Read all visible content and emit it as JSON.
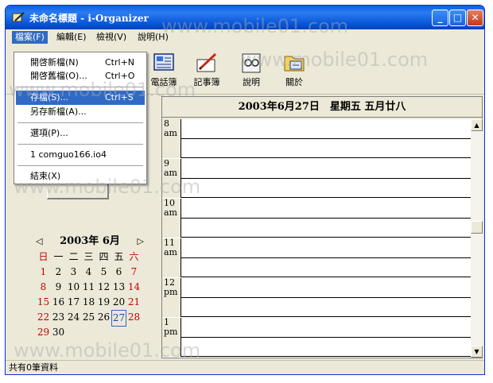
{
  "window": {
    "title": "未命名標題 - i-Organizer",
    "controls": {
      "minimize": "_",
      "maximize": "□",
      "close": "✕"
    }
  },
  "menubar": {
    "items": [
      "檔案(F)",
      "編輯(E)",
      "檢視(V)",
      "說明(H)"
    ]
  },
  "file_menu": {
    "items": [
      {
        "label": "開啓新檔(N)",
        "shortcut": "Ctrl+N"
      },
      {
        "label": "開啓舊檔(O)...",
        "shortcut": "Ctrl+O"
      },
      {
        "label": "存檔(S)...",
        "shortcut": "Ctrl+S"
      },
      {
        "label": "另存新檔(A)...",
        "shortcut": ""
      },
      {
        "label": "選項(P)...",
        "shortcut": ""
      },
      {
        "label": "1 comguo166.io4",
        "shortcut": ""
      },
      {
        "label": "結束(X)",
        "shortcut": ""
      }
    ],
    "highlighted_index": 2
  },
  "toolbar": {
    "phonebook": "電話簿",
    "notepad": "記事簿",
    "help": "說明",
    "about": "關於"
  },
  "calendar": {
    "month_title": "2003年 6月",
    "prev_arrow": "◁",
    "next_arrow": "▷",
    "weekdays": [
      "日",
      "一",
      "二",
      "三",
      "四",
      "五",
      "六"
    ],
    "weeks": [
      [
        "1",
        "2",
        "3",
        "4",
        "5",
        "6",
        "7"
      ],
      [
        "8",
        "9",
        "10",
        "11",
        "12",
        "13",
        "14"
      ],
      [
        "15",
        "16",
        "17",
        "18",
        "19",
        "20",
        "21"
      ],
      [
        "22",
        "23",
        "24",
        "25",
        "26",
        "27",
        "28"
      ],
      [
        "29",
        "30",
        "",
        "",
        "",
        "",
        ""
      ]
    ],
    "selected_day": "27",
    "colors": {
      "weekend": "#c00000",
      "selected": "#2040c0"
    }
  },
  "day_view": {
    "header": "2003年6月27日　星期五 五月廿八",
    "slots": [
      {
        "hour": "8",
        "period": "am"
      },
      {
        "hour": "9",
        "period": "am"
      },
      {
        "hour": "10",
        "period": "am"
      },
      {
        "hour": "11",
        "period": "am"
      },
      {
        "hour": "12",
        "period": "pm"
      },
      {
        "hour": "1",
        "period": "pm"
      }
    ],
    "scroll_up": "▲",
    "scroll_down": "▼"
  },
  "statusbar": {
    "text": "共有0筆資料"
  },
  "watermark": {
    "text": "www.mobile01.com"
  },
  "colors": {
    "titlebar": "#0a5fe8",
    "menu_highlight": "#316ac5",
    "window_bg": "#ece9d8"
  }
}
